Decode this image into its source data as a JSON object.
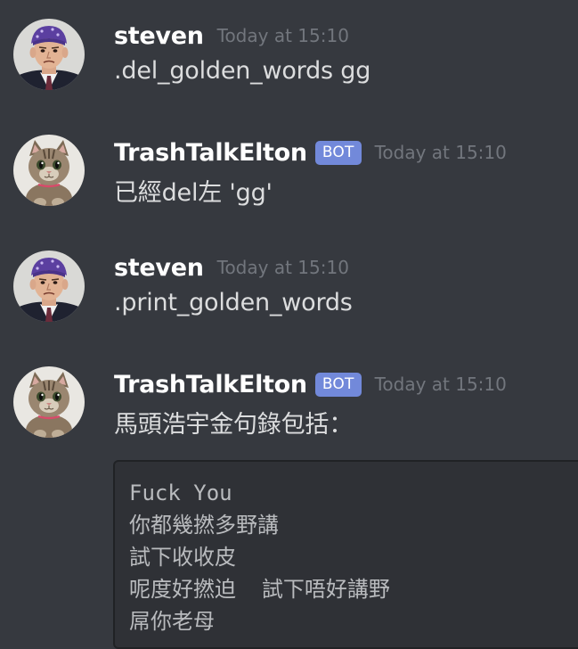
{
  "messages": [
    {
      "author": "steven",
      "avatar_icon": "steven-avatar-icon",
      "timestamp": "Today at 15:10",
      "text": ".del_golden_words gg"
    },
    {
      "author": "TrashTalkElton",
      "avatar_icon": "cat-avatar-icon",
      "bot_tag": "BOT",
      "timestamp": "Today at 15:10",
      "text": "已經del左 'gg'"
    },
    {
      "author": "steven",
      "avatar_icon": "steven-avatar-icon",
      "timestamp": "Today at 15:10",
      "text": ".print_golden_words"
    },
    {
      "author": "TrashTalkElton",
      "avatar_icon": "cat-avatar-icon",
      "bot_tag": "BOT",
      "timestamp": "Today at 15:10",
      "text": "馬頭浩宇金句錄包括：",
      "code_lines": [
        "Fuck You",
        "你都幾撚多野講",
        "試下收收皮",
        "呢度好撚迫  試下唔好講野",
        "屌你老母"
      ]
    }
  ],
  "colors": {
    "background": "#36393f",
    "username": "#ffffff",
    "timestamp": "#72767d",
    "message_text": "#dcddde",
    "bot_tag": "#7289da",
    "codeblock_bg": "#2f3136",
    "codeblock_border": "#202225"
  }
}
